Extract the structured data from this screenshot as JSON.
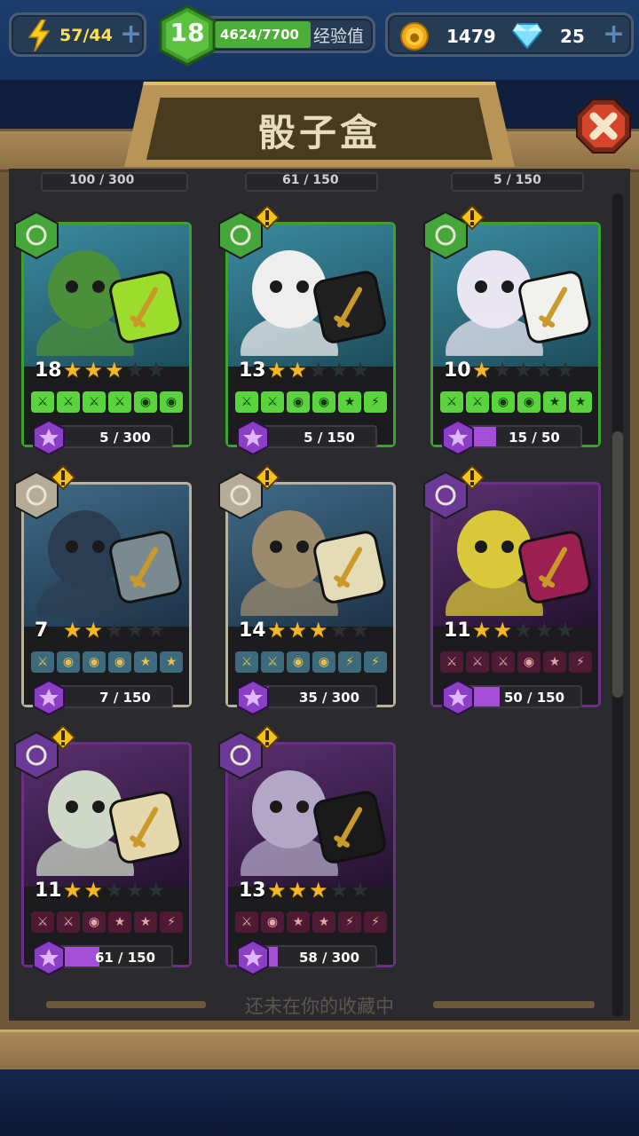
{
  "topbar": {
    "energy": "57/44",
    "level": "18",
    "xp_text": "4624/7700",
    "xp_label": "经验值",
    "xp_progress": 0.6,
    "coins": "1479",
    "gems": "25"
  },
  "title": "骰子盒",
  "partial_row": [
    "100 / 300",
    "61 / 150",
    "5 / 150"
  ],
  "cards": [
    {
      "level": "18",
      "stars": 3,
      "progress_text": "5 / 300",
      "progress": 0.017,
      "type": "green",
      "alert": false,
      "faces": [
        "⚔",
        "⚔",
        "⚔",
        "⚔",
        "◉",
        "◉"
      ]
    },
    {
      "level": "13",
      "stars": 2,
      "progress_text": "5 / 150",
      "progress": 0.033,
      "type": "green",
      "alert": true,
      "faces": [
        "⚔",
        "⚔",
        "◉",
        "◉",
        "★",
        "⚡"
      ]
    },
    {
      "level": "10",
      "stars": 1,
      "progress_text": "15 / 50",
      "progress": 0.3,
      "type": "green",
      "alert": true,
      "faces": [
        "⚔",
        "⚔",
        "◉",
        "◉",
        "★",
        "★"
      ]
    },
    {
      "level": "7",
      "stars": 2,
      "progress_text": "7 / 150",
      "progress": 0.047,
      "type": "gray",
      "alert": true,
      "faces": [
        "⚔",
        "◉",
        "◉",
        "◉",
        "★",
        "★"
      ]
    },
    {
      "level": "14",
      "stars": 3,
      "progress_text": "35 / 300",
      "progress": 0.117,
      "type": "gray",
      "alert": true,
      "faces": [
        "⚔",
        "⚔",
        "◉",
        "◉",
        "⚡",
        "⚡"
      ]
    },
    {
      "level": "11",
      "stars": 2,
      "progress_text": "50 / 150",
      "progress": 0.333,
      "type": "purple",
      "alert": true,
      "faces": [
        "⚔",
        "⚔",
        "⚔",
        "◉",
        "★",
        "⚡"
      ]
    },
    {
      "level": "11",
      "stars": 2,
      "progress_text": "61 / 150",
      "progress": 0.407,
      "type": "purple",
      "alert": true,
      "faces": [
        "⚔",
        "⚔",
        "◉",
        "★",
        "★",
        "⚡"
      ]
    },
    {
      "level": "13",
      "stars": 3,
      "progress_text": "58 / 300",
      "progress": 0.193,
      "type": "purple",
      "alert": true,
      "faces": [
        "⚔",
        "◉",
        "★",
        "★",
        "⚡",
        "⚡"
      ]
    }
  ],
  "footer_note": "还未在你的收藏中",
  "colors": {
    "green": "#3aa32e",
    "gray": "#b8b2a3",
    "purple": "#6b2f86"
  }
}
